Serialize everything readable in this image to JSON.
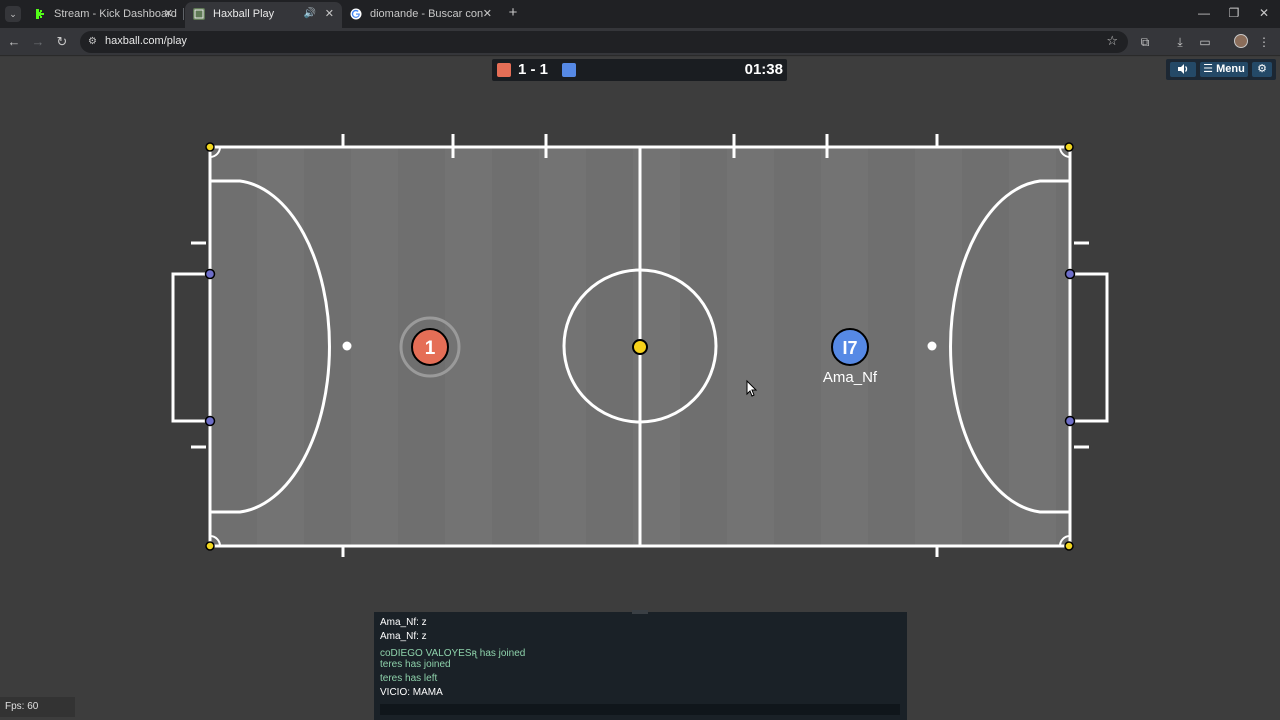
{
  "browser": {
    "tabs": [
      {
        "title": "Stream - Kick Dashboard",
        "active": false
      },
      {
        "title": "Haxball Play",
        "active": true
      },
      {
        "title": "diomande - Buscar con Google",
        "active": false
      }
    ],
    "url": "haxball.com/play"
  },
  "scoreboard": {
    "score": "1 - 1",
    "time": "01:38",
    "red_color": "#e56e56",
    "blue_color": "#5689e5"
  },
  "top_controls": {
    "sound_icon": "speaker-icon",
    "menu_label": "Menu",
    "settings_icon": "gear-icon"
  },
  "players": [
    {
      "team": "red",
      "number": "1",
      "name": ""
    },
    {
      "team": "blue",
      "number": "I7",
      "name": "Ama_Nf"
    }
  ],
  "chat": {
    "messages": [
      {
        "text": "Ama_Nf: z",
        "kind": "user"
      },
      {
        "text": "Ama_Nf: z",
        "kind": "user"
      },
      {
        "text": "coDIEGO VALOYESꭆ has joined",
        "kind": "system"
      },
      {
        "text": "teres has joined",
        "kind": "system"
      },
      {
        "text": "teres has left",
        "kind": "system"
      },
      {
        "text": "VICIO: MAMA",
        "kind": "user"
      }
    ]
  },
  "fps_label": "Fps: 60"
}
